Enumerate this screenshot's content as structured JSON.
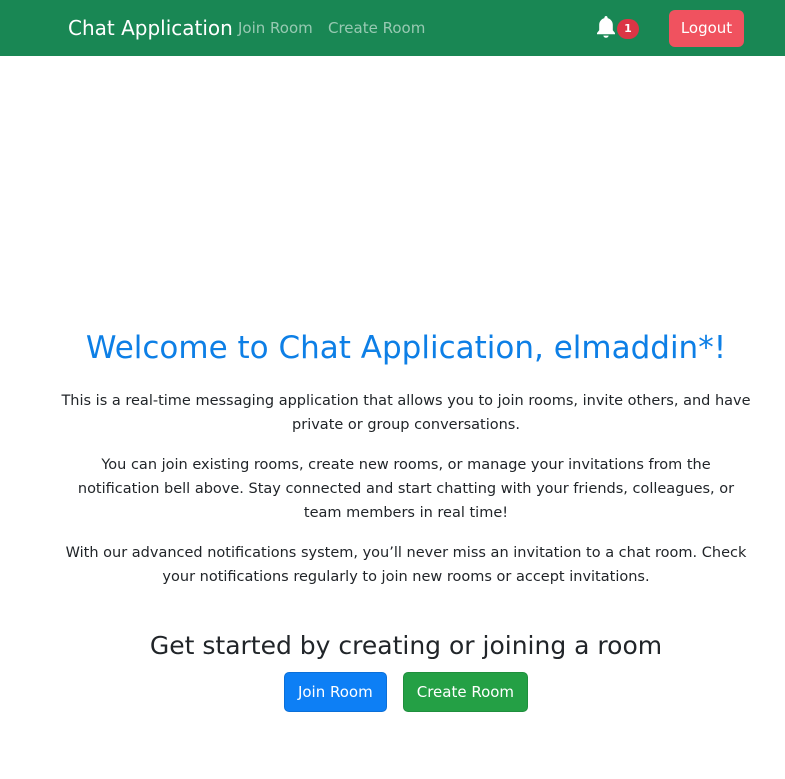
{
  "navbar": {
    "brand": "Chat Application",
    "links": [
      "Join Room",
      "Create Room"
    ],
    "notifications": {
      "icon": "bell-icon",
      "count": "1"
    },
    "logout_label": "Logout"
  },
  "main": {
    "welcome": "Welcome to Chat Application, elmaddin*!",
    "paragraphs": [
      "This is a real-time messaging application that allows you to join rooms, invite others, and have private or group conversations.",
      "You can join existing rooms, create new rooms, or manage your invitations from the notification bell above. Stay connected and start chatting with your friends, colleagues, or team members in real time!",
      "With our advanced notifications system, you’ll never miss an invitation to a chat room. Check your notifications regularly to join new rooms or accept invitations."
    ],
    "cta_heading": "Get started by creating or joining a room",
    "join_button": "Join Room",
    "create_button": "Create Room"
  },
  "colors": {
    "navbar_bg": "#198754",
    "welcome_text": "#0d7fe6",
    "logout_bg": "#f0525f",
    "badge_bg": "#dc3545",
    "primary_button": "#0d7ff5",
    "success_button": "#24a045"
  }
}
